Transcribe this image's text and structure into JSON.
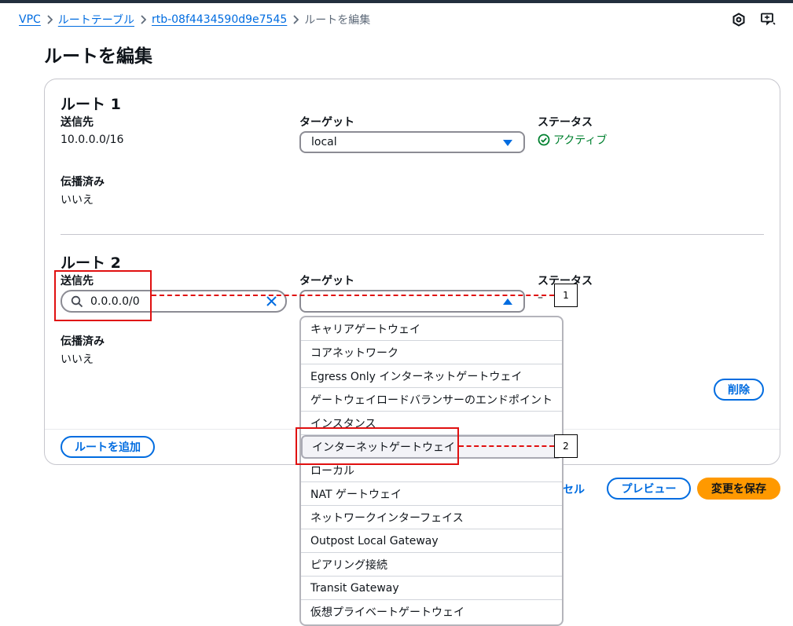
{
  "breadcrumb": {
    "items": [
      "VPC",
      "ルートテーブル",
      "rtb-08f4434590d9e7545"
    ],
    "current": "ルートを編集"
  },
  "icons": {
    "top_right": [
      "settings-hex-icon",
      "feedback-icon"
    ],
    "search": "search-icon",
    "clear": "clear-x-icon",
    "caret": "caret-icon",
    "status": "check-circle-icon"
  },
  "page": {
    "title": "ルートを編集"
  },
  "routes": [
    {
      "title": "ルート 1",
      "destination_label": "送信先",
      "destination_value": "10.0.0.0/16",
      "target_label": "ターゲット",
      "target_value": "local",
      "status_label": "ステータス",
      "status_value": "アクティブ",
      "propagated_label": "伝播済み",
      "propagated_value": "いいえ"
    },
    {
      "title": "ルート 2",
      "destination_label": "送信先",
      "destination_value": "0.0.0.0/0",
      "target_label": "ターゲット",
      "target_value": "",
      "status_label": "ステータス",
      "status_value": "–",
      "propagated_label": "伝播済み",
      "propagated_value": "いいえ",
      "delete_label": "削除"
    }
  ],
  "dropdown": {
    "options": [
      "キャリアゲートウェイ",
      "コアネットワーク",
      "Egress Only インターネットゲートウェイ",
      "ゲートウェイロードバランサーのエンドポイント",
      "インスタンス",
      "インターネットゲートウェイ",
      "ローカル",
      "NAT ゲートウェイ",
      "ネットワークインターフェイス",
      "Outpost Local Gateway",
      "ピアリング接続",
      "Transit Gateway",
      "仮想プライベートゲートウェイ"
    ],
    "highlighted_index": 5
  },
  "footer": {
    "add_route": "ルートを追加",
    "cancel_partial": "セル",
    "preview": "プレビュー",
    "save": "変更を保存"
  },
  "annotations": [
    "1",
    "2"
  ],
  "colors": {
    "link": "#006ce0",
    "primary": "#ff9900",
    "success": "#00802f",
    "annotation": "#e01010"
  }
}
